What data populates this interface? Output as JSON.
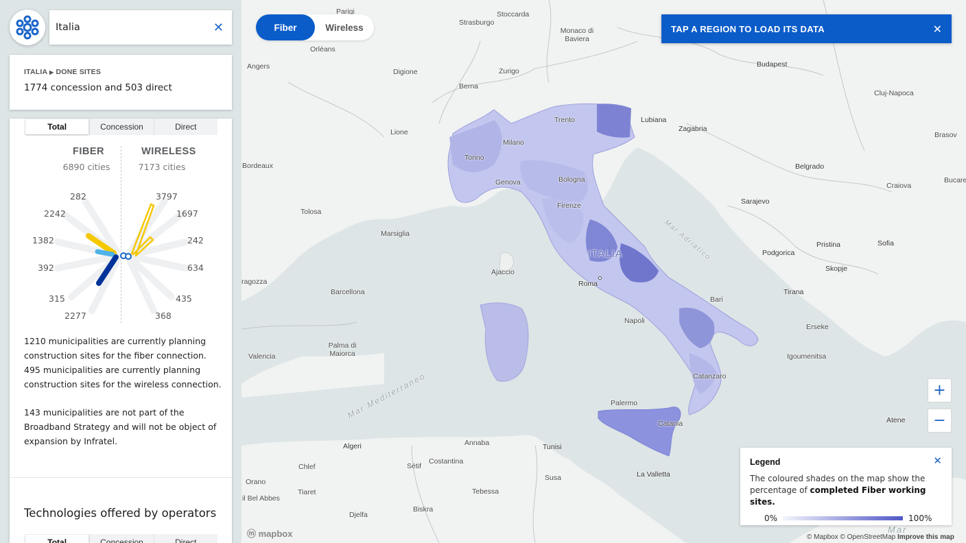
{
  "search": {
    "value": "Italia",
    "clear_icon": "close-icon"
  },
  "info_card": {
    "breadcrumb_root": "ITALIA",
    "breadcrumb_leaf": "DONE SITES",
    "summary": "1774 concession and 503 direct"
  },
  "stats": {
    "tabs": [
      "Total",
      "Concession",
      "Direct"
    ],
    "active_tab": "Total",
    "fiber": {
      "title": "FIBER",
      "subtitle": "6890 cities",
      "values": [
        "282",
        "2242",
        "1382",
        "392",
        "315",
        "2277"
      ]
    },
    "wireless": {
      "title": "WIRELESS",
      "subtitle": "7173 cities",
      "values": [
        "3797",
        "1697",
        "242",
        "634",
        "435",
        "368"
      ]
    },
    "paragraph_1": "1210 municipalities are currently planning construction sites for the fiber connection. 495 municipalities are currently planning construction sites for the wireless connection.",
    "paragraph_2": "143 municipalities are not part of the Broadband Strategy and will not be object of expansion by Infratel.",
    "technologies_title": "Technologies offered by operators",
    "technologies_tabs": [
      "Total",
      "Concession",
      "Direct"
    ]
  },
  "mode_toggle": {
    "options": [
      "Fiber",
      "Wireless"
    ],
    "active": "Fiber"
  },
  "banner": {
    "text": "TAP A REGION TO LOAD ITS DATA"
  },
  "zoom": {
    "in": "+",
    "out": "−"
  },
  "legend": {
    "title": "Legend",
    "desc_before": "The coloured shades on the map show the percentage of ",
    "desc_bold": "completed Fiber working sites.",
    "min": "0%",
    "max": "100%",
    "gradient_colors": [
      "#f3f4fb",
      "#5057c7"
    ]
  },
  "map": {
    "country_label": "ITALIA",
    "seas": [
      "Mar Mediterraneo",
      "Mar Adriatico"
    ],
    "cities": [
      "Parigi",
      "Stoccarda",
      "Strasburgo",
      "Monaco di Baviera",
      "Orléans",
      "Angers",
      "Digione",
      "Zurigo",
      "Budapest",
      "Berna",
      "Cluj-Napoca",
      "Trento",
      "Lubiana",
      "Zagabria",
      "Lione",
      "Milano",
      "Brasov",
      "Bordeaux",
      "Torino",
      "Belgrado",
      "Genova",
      "Bologna",
      "Craiova",
      "Bucare",
      "Tolosa",
      "Firenze",
      "Sarajevo",
      "Marsiglia",
      "Pristina",
      "Sofia",
      "Podgorica",
      "Skopje",
      "Ajaccio",
      "Roma",
      "Tirana",
      "ragozza",
      "Barcellona",
      "Bari",
      "Napoli",
      "Erseke",
      "Palma di Maiorca",
      "Valencia",
      "Igoumenitsa",
      "Catanzaro",
      "Palermo",
      "Catania",
      "Atene",
      "Algeri",
      "Annaba",
      "Tunisi",
      "Chlef",
      "Sétif",
      "Costantina",
      "Orano",
      "Tiaret",
      "Tebessa",
      "Susa",
      "La Valletta",
      "il Bel Abbes",
      "Biskra",
      "Djelfa",
      "Mar"
    ],
    "mapbox_logo": "mapbox",
    "attribution": "© Mapbox © OpenStreetMap",
    "improve_link": "Improve this map"
  },
  "colors": {
    "accent": "#0a5cc9",
    "fiber_bar": "#003399",
    "wireless_bar": "#f5c800"
  }
}
